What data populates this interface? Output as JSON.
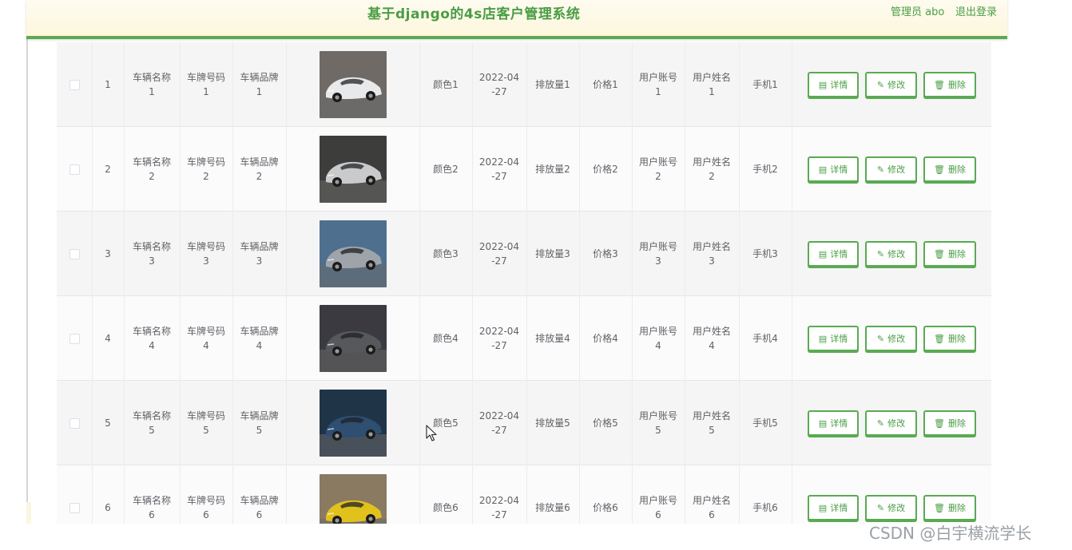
{
  "header": {
    "title": "基于django的4s店客户管理系统",
    "user_label": "管理员 abo",
    "logout_label": "退出登录"
  },
  "actions": {
    "detail": "详情",
    "edit": "修改",
    "delete": "删除"
  },
  "colors": {
    "accent": "#5aaa53",
    "accent_text": "#4a9d44"
  },
  "rows": [
    {
      "index": "1",
      "name": [
        "车辆名称",
        "1"
      ],
      "plate": [
        "车牌号码",
        "1"
      ],
      "brand": [
        "车辆品牌",
        "1"
      ],
      "color": "颜色1",
      "date": [
        "2022-04",
        "-27"
      ],
      "displacement": "排放量1",
      "price": "价格1",
      "account": [
        "用户账号",
        "1"
      ],
      "username": [
        "用户姓名",
        "1"
      ],
      "phone": "手机1"
    },
    {
      "index": "2",
      "name": [
        "车辆名称",
        "2"
      ],
      "plate": [
        "车牌号码",
        "2"
      ],
      "brand": [
        "车辆品牌",
        "2"
      ],
      "color": "颜色2",
      "date": [
        "2022-04",
        "-27"
      ],
      "displacement": "排放量2",
      "price": "价格2",
      "account": [
        "用户账号",
        "2"
      ],
      "username": [
        "用户姓名",
        "2"
      ],
      "phone": "手机2"
    },
    {
      "index": "3",
      "name": [
        "车辆名称",
        "3"
      ],
      "plate": [
        "车牌号码",
        "3"
      ],
      "brand": [
        "车辆品牌",
        "3"
      ],
      "color": "颜色3",
      "date": [
        "2022-04",
        "-27"
      ],
      "displacement": "排放量3",
      "price": "价格3",
      "account": [
        "用户账号",
        "3"
      ],
      "username": [
        "用户姓名",
        "3"
      ],
      "phone": "手机3"
    },
    {
      "index": "4",
      "name": [
        "车辆名称",
        "4"
      ],
      "plate": [
        "车牌号码",
        "4"
      ],
      "brand": [
        "车辆品牌",
        "4"
      ],
      "color": "颜色4",
      "date": [
        "2022-04",
        "-27"
      ],
      "displacement": "排放量4",
      "price": "价格4",
      "account": [
        "用户账号",
        "4"
      ],
      "username": [
        "用户姓名",
        "4"
      ],
      "phone": "手机4"
    },
    {
      "index": "5",
      "name": [
        "车辆名称",
        "5"
      ],
      "plate": [
        "车牌号码",
        "5"
      ],
      "brand": [
        "车辆品牌",
        "5"
      ],
      "color": "颜色5",
      "date": [
        "2022-04",
        "-27"
      ],
      "displacement": "排放量5",
      "price": "价格5",
      "account": [
        "用户账号",
        "5"
      ],
      "username": [
        "用户姓名",
        "5"
      ],
      "phone": "手机5"
    },
    {
      "index": "6",
      "name": [
        "车辆名称",
        "6"
      ],
      "plate": [
        "车牌号码",
        "6"
      ],
      "brand": [
        "车辆品牌",
        "6"
      ],
      "color": "颜色6",
      "date": [
        "2022-04",
        "-27"
      ],
      "displacement": "排放量6",
      "price": "价格6",
      "account": [
        "用户账号",
        "6"
      ],
      "username": [
        "用户姓名",
        "6"
      ],
      "phone": "手机6"
    }
  ],
  "car_images": [
    {
      "bg": "#6f6a66",
      "body": "#e8e9ea"
    },
    {
      "bg": "#3d3d3b",
      "body": "#c8cacc"
    },
    {
      "bg": "#4f6f8e",
      "body": "#9ea4aa"
    },
    {
      "bg": "#3a3a40",
      "body": "#56585c"
    },
    {
      "bg": "#203448",
      "body": "#2e4e72"
    },
    {
      "bg": "#8a7a62",
      "body": "#e1c21d"
    }
  ],
  "watermark": "CSDN @白宇横流学长"
}
